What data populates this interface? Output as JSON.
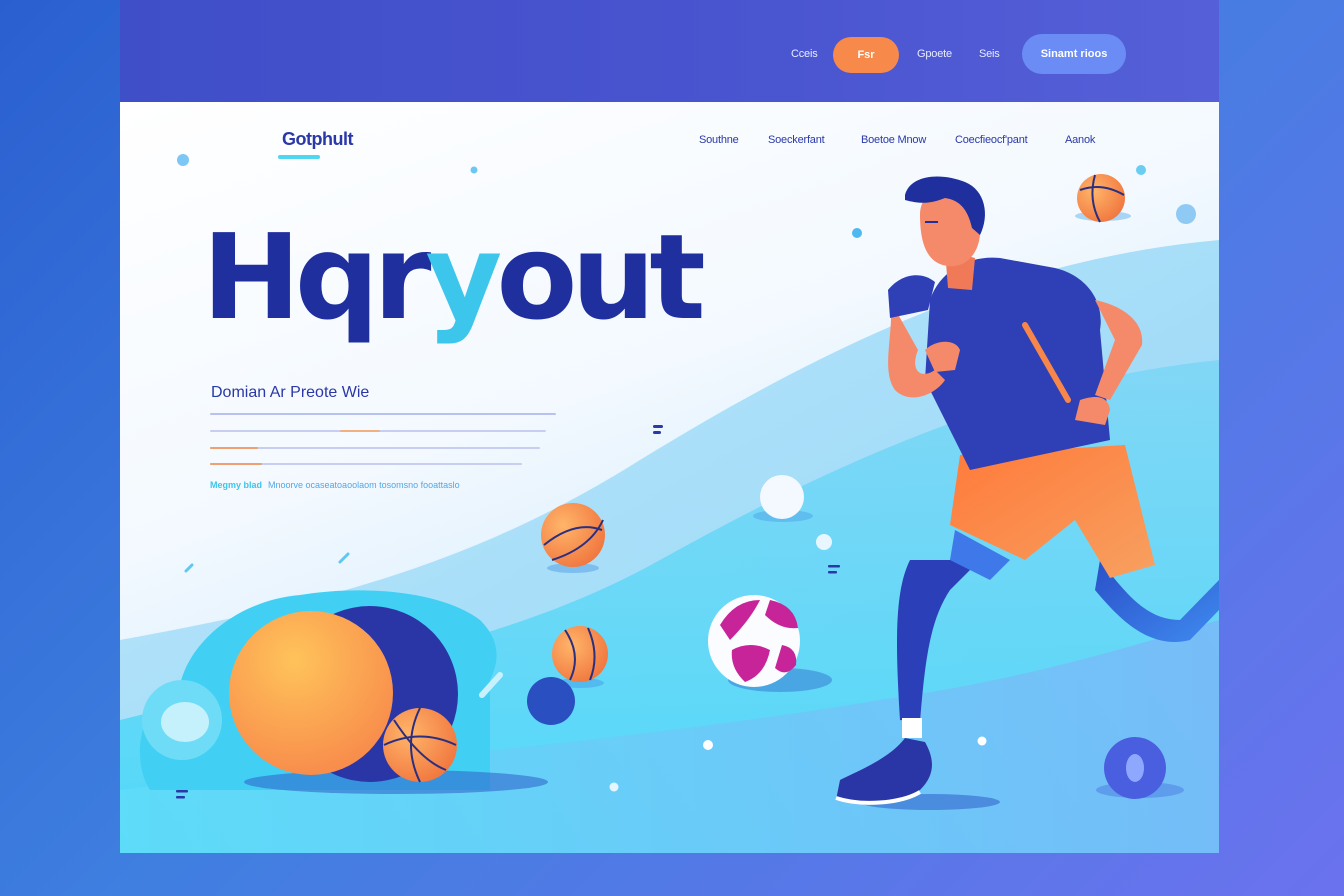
{
  "topbar": {
    "nav": [
      "Cceis",
      "Fsr",
      "Gpoete",
      "Seis",
      "Sinamt rioos"
    ]
  },
  "brand": {
    "logo": "Gotphult"
  },
  "subnav": [
    "Southne",
    "Soeckerfant",
    "Boetoe Mnow",
    "Coecfieocf'pant",
    "Aanok"
  ],
  "hero": {
    "title_part1": "Hqr",
    "title_accent": "y",
    "title_part2": "out",
    "subtitle": "Domian Ar Preote Wie",
    "link_label": "Megmy blad",
    "link_text": "Mnoorve ocaseatoaoolaom tosomsno fooattaslo"
  },
  "colors": {
    "brand_dark": "#1f2f9e",
    "accent_cyan": "#3dc6ec",
    "accent_orange": "#f7894a",
    "topbar": "#4a55d0"
  }
}
